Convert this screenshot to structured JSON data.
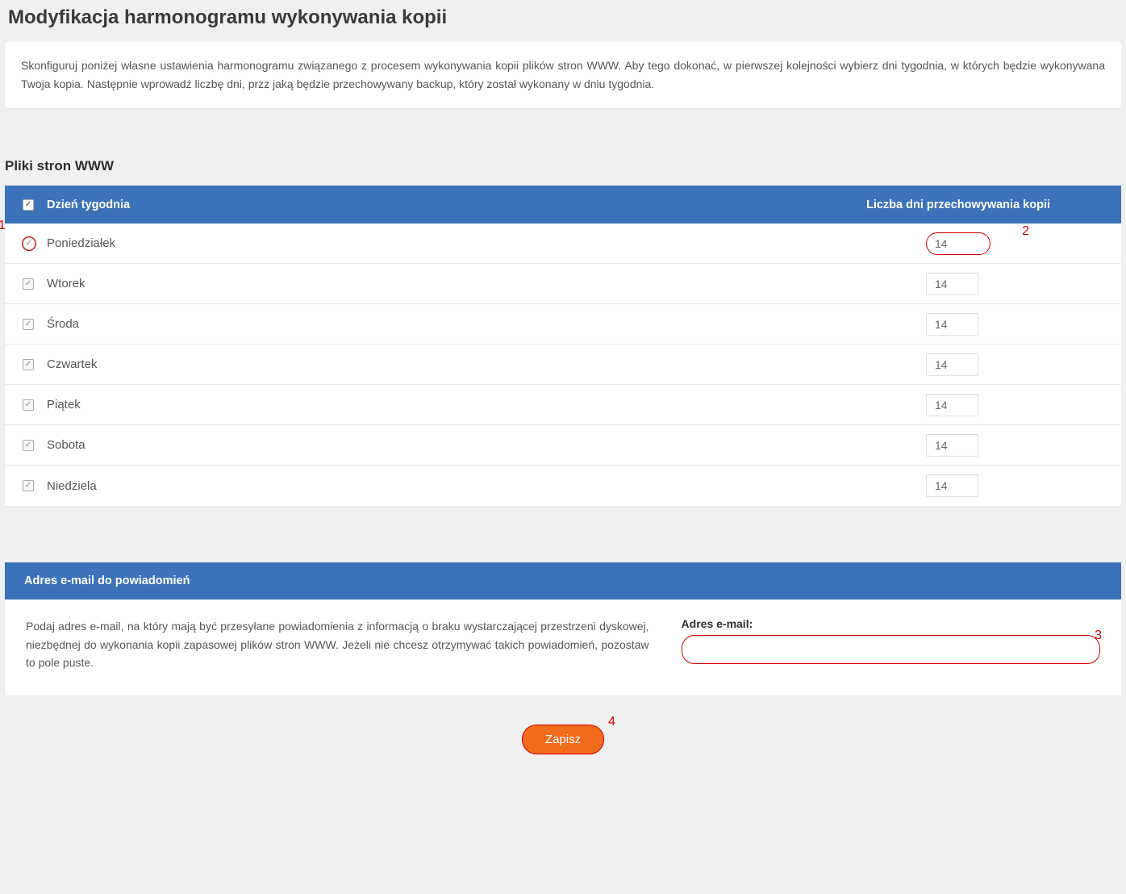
{
  "page": {
    "title": "Modyfikacja harmonogramu wykonywania kopii",
    "description": "Skonfiguruj poniżej własne ustawienia harmonogramu związanego z procesem wykonywania kopii plików stron WWW. Aby tego dokonać, w pierwszej kolejności wybierz dni tygodnia, w których będzie wykonywana Twoja kopia. Następnie wprowadź liczbę dni, przz jaką będzie przechowywany backup, który został wykonany w dniu tygodnia."
  },
  "section": {
    "title": "Pliki stron WWW",
    "header_day": "Dzień tygodnia",
    "header_days_keep": "Liczba dni przechowywania kopii"
  },
  "days": [
    {
      "name": "Poniedziałek",
      "checked": true,
      "value": "14"
    },
    {
      "name": "Wtorek",
      "checked": true,
      "value": "14"
    },
    {
      "name": "Środa",
      "checked": true,
      "value": "14"
    },
    {
      "name": "Czwartek",
      "checked": true,
      "value": "14"
    },
    {
      "name": "Piątek",
      "checked": true,
      "value": "14"
    },
    {
      "name": "Sobota",
      "checked": true,
      "value": "14"
    },
    {
      "name": "Niedziela",
      "checked": true,
      "value": "14"
    }
  ],
  "email": {
    "header": "Adres e-mail do powiadomień",
    "desc": "Podaj adres e-mail, na który mają być przesyłane powiadomienia z informacją o braku wystarczającej przestrzeni dyskowej, niezbędnej do wykonania kopii zapasowej plików stron WWW. Jeżeli nie chcesz otrzymywać takich powiadomień, pozostaw to pole puste.",
    "label": "Adres e-mail:",
    "value": ""
  },
  "actions": {
    "save": "Zapisz"
  },
  "annotations": {
    "a1": "1",
    "a2": "2",
    "a3": "3",
    "a4": "4"
  }
}
